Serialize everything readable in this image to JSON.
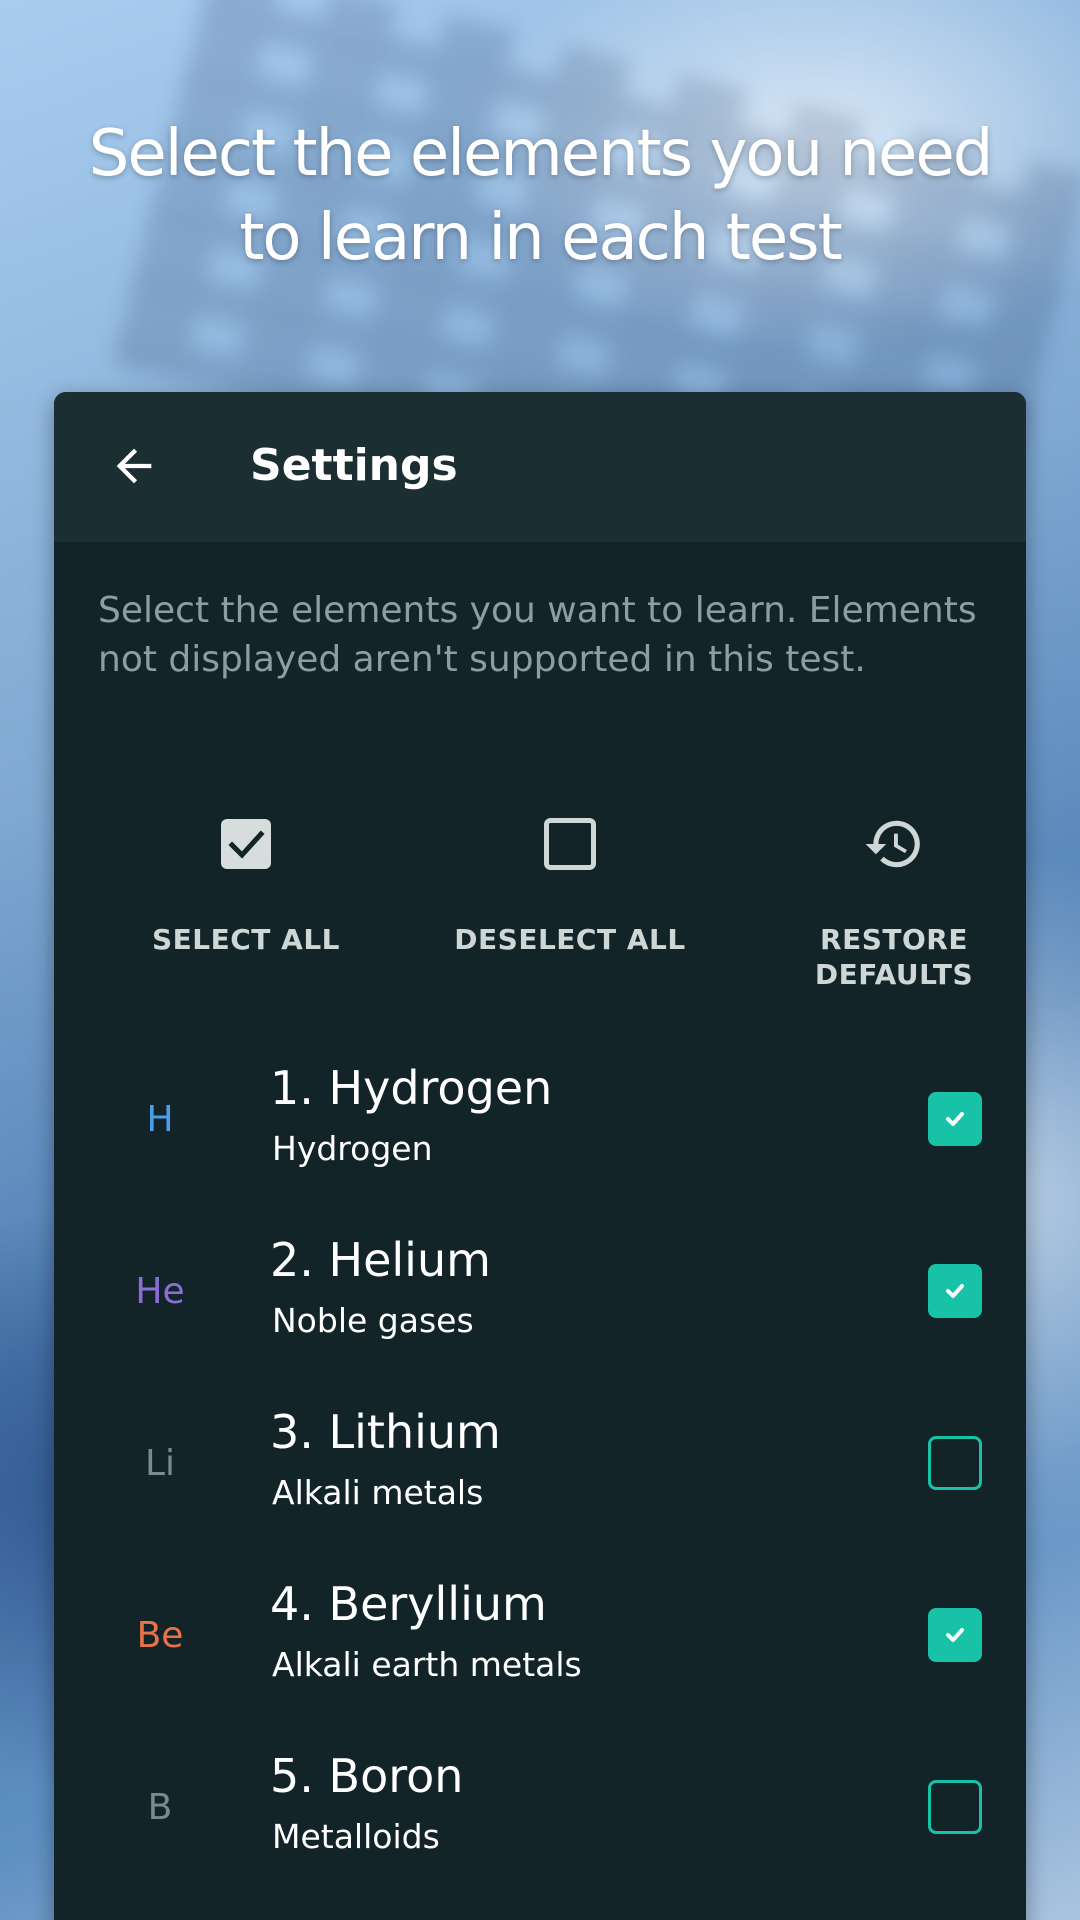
{
  "headline": {
    "line1": "Select the elements you need",
    "line2": "to learn in each test"
  },
  "toolbar": {
    "title": "Settings",
    "back_icon": "arrow-left-icon"
  },
  "description": "Select the elements you want to learn. Elements not displayed aren't supported in this test.",
  "actions": [
    {
      "label": "SELECT ALL",
      "icon": "checkbox-checked-icon"
    },
    {
      "label": "DESELECT ALL",
      "icon": "checkbox-empty-icon"
    },
    {
      "label_line1": "RESTORE",
      "label_line2": "DEFAULTS",
      "icon": "history-icon"
    }
  ],
  "colors": {
    "accent": "#17c2a6",
    "card_bg": "#132428",
    "toolbar_bg": "#1b2e32"
  },
  "elements": [
    {
      "symbol": "H",
      "name": "1. Hydrogen",
      "category": "Hydrogen",
      "checked": true,
      "symbol_color": "#4a9fe8"
    },
    {
      "symbol": "He",
      "name": "2. Helium",
      "category": "Noble gases",
      "checked": true,
      "symbol_color": "#8b6fd6"
    },
    {
      "symbol": "Li",
      "name": "3. Lithium",
      "category": "Alkali metals",
      "checked": false,
      "symbol_color": "#7d8a8c"
    },
    {
      "symbol": "Be",
      "name": "4. Beryllium",
      "category": "Alkali earth metals",
      "checked": true,
      "symbol_color": "#e8734a"
    },
    {
      "symbol": "B",
      "name": "5. Boron",
      "category": "Metalloids",
      "checked": false,
      "symbol_color": "#7d8a8c"
    }
  ]
}
